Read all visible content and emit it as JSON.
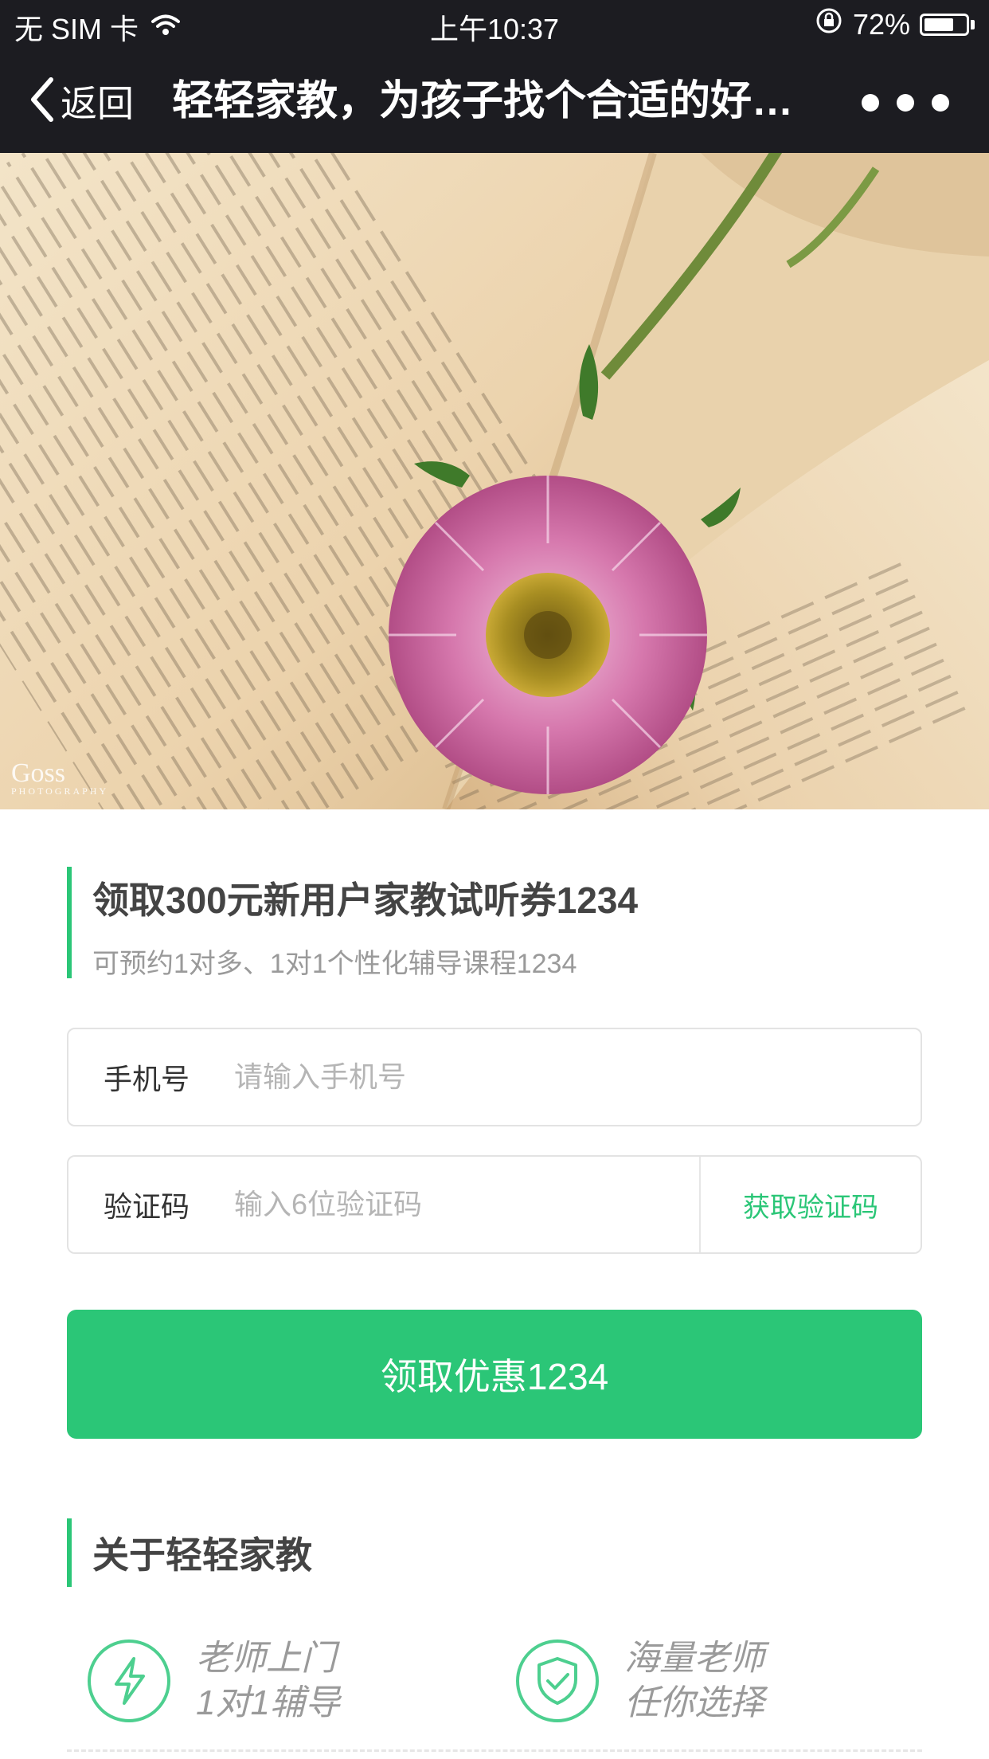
{
  "status_bar": {
    "carrier": "无 SIM 卡",
    "time": "上午10:37",
    "battery": "72%",
    "battery_level": 0.72
  },
  "nav": {
    "back_label": "返回",
    "title": "轻轻家教，为孩子找个合适的好…"
  },
  "hero": {
    "watermark_main": "Goss",
    "watermark_sub": "PHOTOGRAPHY"
  },
  "promo": {
    "title": "领取300元新用户家教试听券1234",
    "subtitle": "可预约1对多、1对1个性化辅导课程1234"
  },
  "form": {
    "phone_label": "手机号",
    "phone_placeholder": "请输入手机号",
    "phone_value": "",
    "code_label": "验证码",
    "code_placeholder": "输入6位验证码",
    "code_value": "",
    "get_code_label": "获取验证码",
    "submit_label": "领取优惠1234"
  },
  "about": {
    "title": "关于轻轻家教",
    "features": [
      {
        "icon": "lightning-icon",
        "line1": "老师上门",
        "line2": "1对1辅导"
      },
      {
        "icon": "shield-check-icon",
        "line1": "海量老师",
        "line2": "任你选择"
      }
    ]
  },
  "colors": {
    "accent": "#2bc677",
    "nav_bg": "#1c1c21",
    "text_dark": "#444444",
    "text_muted": "#9a9a9a"
  }
}
